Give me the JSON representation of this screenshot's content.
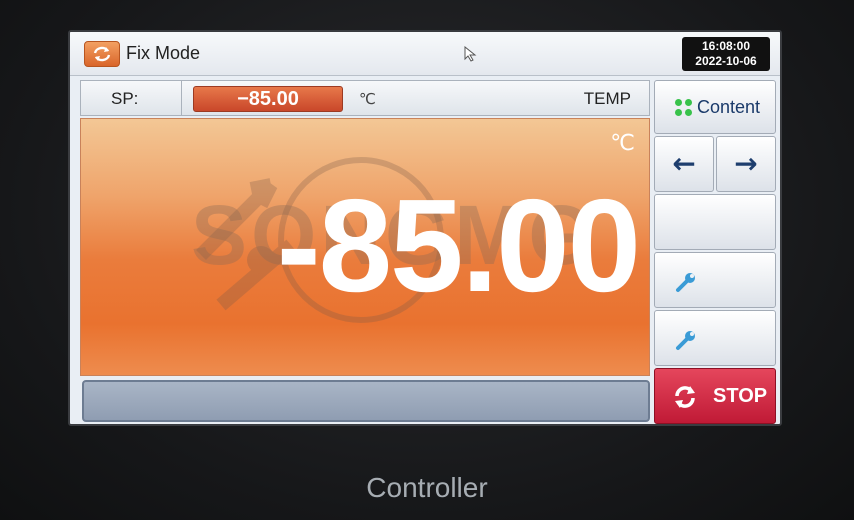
{
  "titlebar": {
    "mode_label": "Fix Mode",
    "mode_icon": "refresh-icon",
    "time": "16:08:00",
    "date": "2022-10-06"
  },
  "setpoint": {
    "label": "SP:",
    "value": "−85.00",
    "unit": "℃",
    "mode": "TEMP"
  },
  "display": {
    "value": "-85.00",
    "unit": "℃",
    "watermark": "SONGMG"
  },
  "sidebar": {
    "content_label": "Content",
    "prev_glyph": "←",
    "next_glyph": "→",
    "stop_label": "STOP"
  },
  "device": {
    "label": "Controller"
  },
  "colors": {
    "accent_orange": "#e9722f",
    "stop_red": "#c01a36",
    "content_dot_green": "#38c24a"
  }
}
